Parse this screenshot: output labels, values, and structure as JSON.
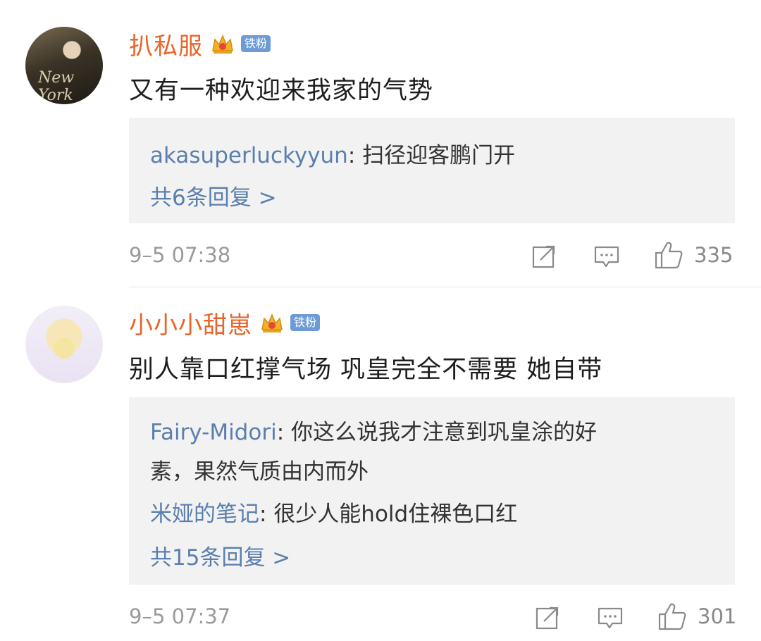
{
  "comments": [
    {
      "username": "扒私服",
      "badge": "铁粉",
      "crown_icon": "crown-icon",
      "text": "又有一种欢迎来我家的气势",
      "replies": [
        {
          "name": "akasuperluckyyun",
          "sep": ": ",
          "text": "扫径迎客鹏门开"
        }
      ],
      "more_replies": "共6条回复 >",
      "time": "9–5 07:38",
      "likes": "335"
    },
    {
      "username": "小小小甜崽",
      "badge": "铁粉",
      "crown_icon": "crown-icon",
      "text": "别人靠口红撑气场 巩皇完全不需要 她自带",
      "replies": [
        {
          "name": "Fairy-Midori",
          "sep": ": ",
          "text": "你这么说我才注意到巩皇涂的好",
          "text2": "素，果然气质由内而外"
        },
        {
          "name": "米娅的笔记",
          "sep": ": ",
          "text": "很少人能hold住裸色口红"
        }
      ],
      "more_replies": "共15条回复 >",
      "time": "9–5 07:37",
      "likes": "301"
    }
  ],
  "avatar1_deco": "New York",
  "icons": {
    "forward": "share-icon",
    "comment": "comment-icon",
    "like": "thumbs-up-icon"
  },
  "colors": {
    "username": "#e8642a",
    "reply_name": "#5a7fae",
    "badge": "#6c9bd6",
    "reply_bg": "#f2f2f2"
  }
}
